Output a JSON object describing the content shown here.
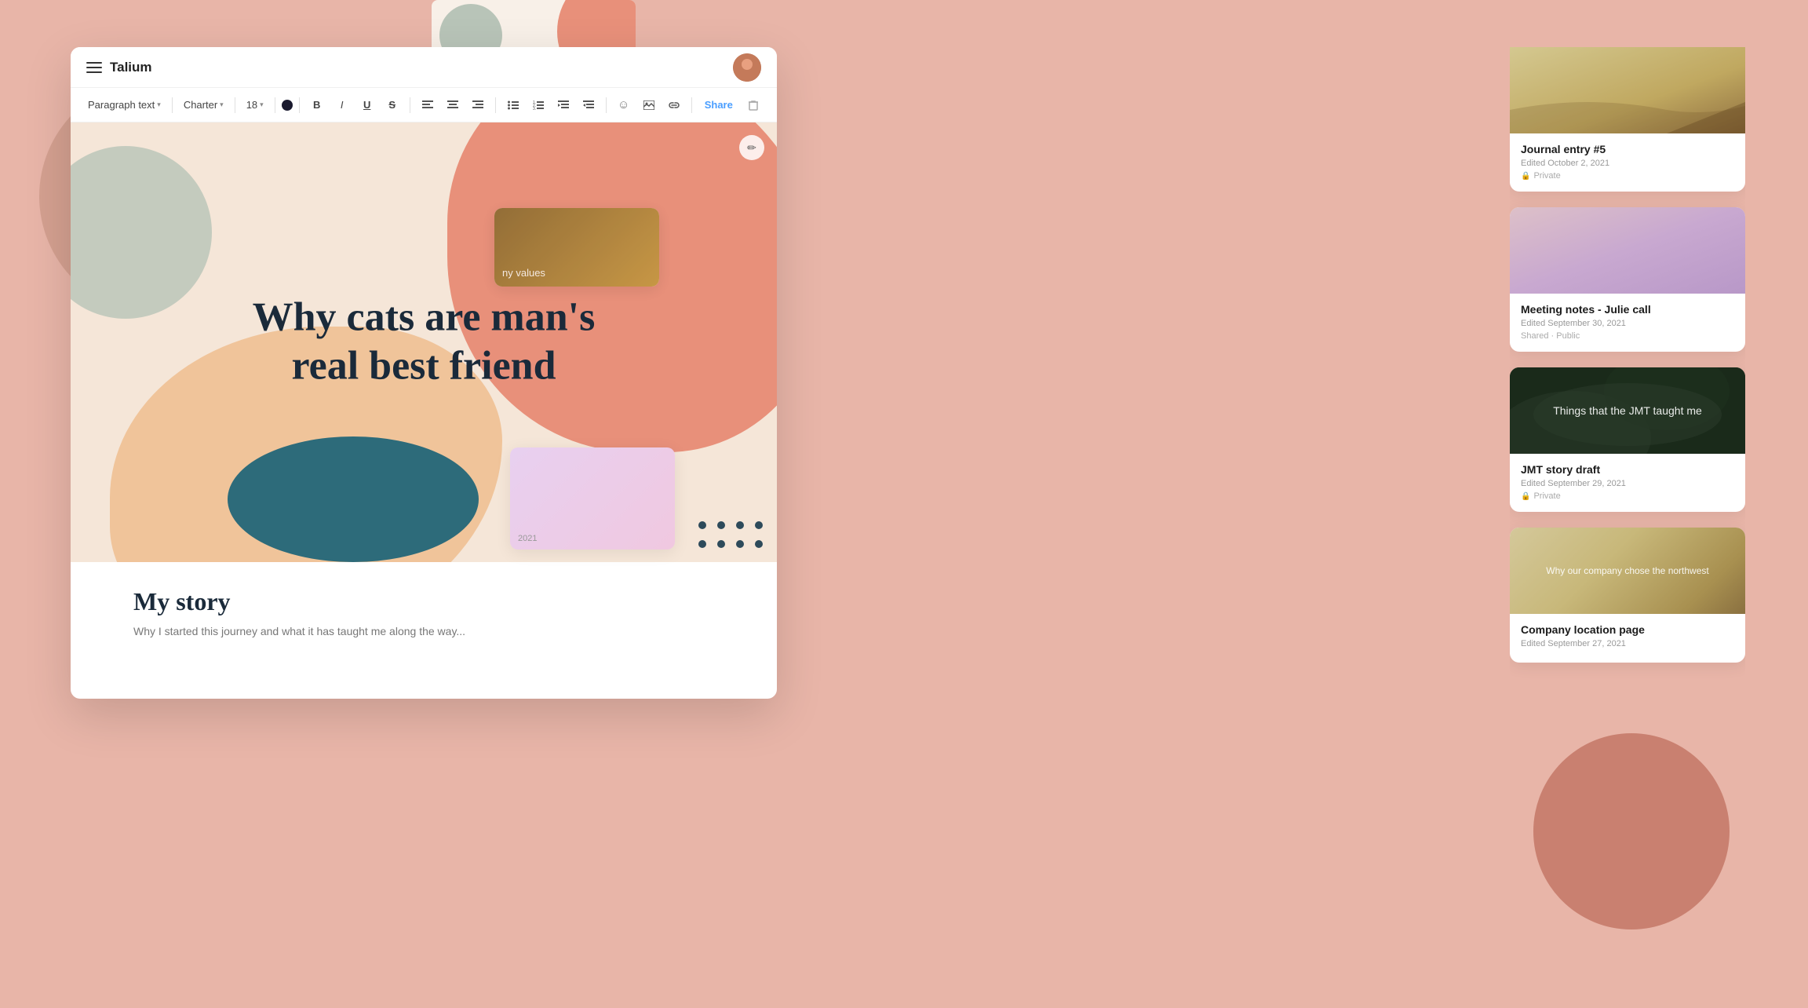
{
  "app": {
    "name": "Talium",
    "logo_text": "Talium"
  },
  "toolbar": {
    "paragraph_style": "Paragraph text",
    "font": "Charter",
    "font_size": "18",
    "bold_label": "B",
    "italic_label": "I",
    "underline_label": "U",
    "strikethrough_label": "S",
    "share_label": "Share"
  },
  "editor": {
    "hero_title": "Why cats are man's real best friend",
    "content_heading": "My story",
    "content_body": "Why I started this journey and what it has taught me along the way..."
  },
  "cards": [
    {
      "id": "journal5",
      "title": "Journal entry #5",
      "edited": "Edited October 2, 2021",
      "status": "Private",
      "thumb_type": "ocean"
    },
    {
      "id": "meeting-notes",
      "title": "Meeting notes - Julie call",
      "edited": "Edited September 30, 2021",
      "status": "Shared · Public",
      "thumb_type": "gradient-pink"
    },
    {
      "id": "jmt-story",
      "title": "JMT story draft",
      "edited": "Edited September 29, 2021",
      "status": "Private",
      "thumb_type": "dark-leaves",
      "thumb_text": "Things that the JMT taught me"
    },
    {
      "id": "company-location",
      "title": "Company location page",
      "edited": "Edited September 27, 2021",
      "status": "",
      "thumb_type": "company",
      "thumb_text": "Why our company chose the northwest"
    }
  ],
  "partial_card": {
    "text": "ny values",
    "edited": "2021"
  }
}
